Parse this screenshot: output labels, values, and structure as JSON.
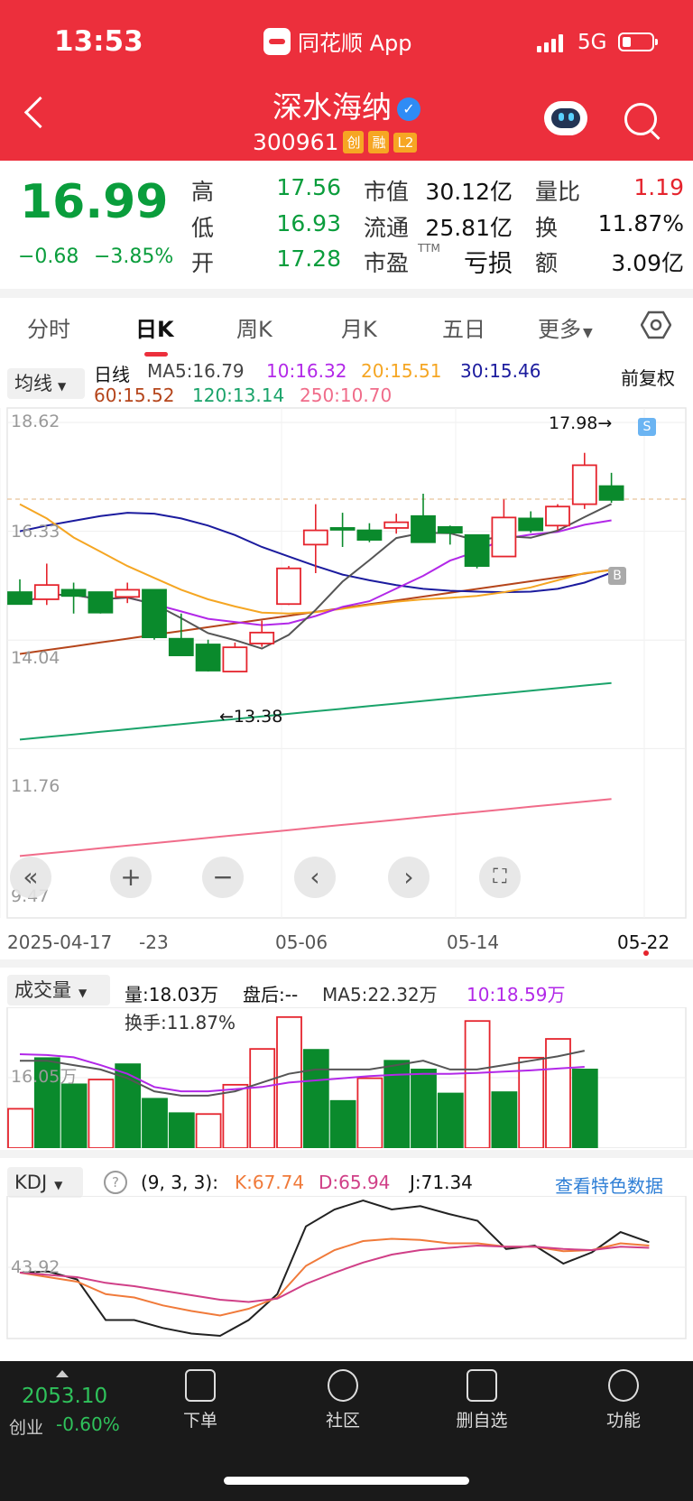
{
  "status": {
    "time": "13:53",
    "app": "同花顺 App",
    "network": "5G"
  },
  "header": {
    "stock_name": "深水海纳",
    "stock_code": "300961",
    "tags": [
      "创",
      "融",
      "L2"
    ]
  },
  "quote": {
    "price": "16.99",
    "change": "−0.68",
    "change_pct": "−3.85%",
    "high_label": "高",
    "high": "17.56",
    "low_label": "低",
    "low": "16.93",
    "open_label": "开",
    "open": "17.28",
    "mcap_label": "市值",
    "mcap": "30.12亿",
    "float_label": "流通",
    "float": "25.81亿",
    "pe_label": "市盈",
    "pe_sup": "TTM",
    "pe": "亏损",
    "vr_label": "量比",
    "vr": "1.19",
    "turn_label": "换",
    "turn": "11.87%",
    "amt_label": "额",
    "amt": "3.09亿"
  },
  "tabs": [
    "分时",
    "日K",
    "周K",
    "月K",
    "五日",
    "更多"
  ],
  "ma_legend": {
    "selector": "均线",
    "period": "日线",
    "ma5": "MA5:16.79",
    "ma10": "10:16.32",
    "ma20": "20:15.51",
    "ma30": "30:15.46",
    "ma60": "60:15.52",
    "ma120": "120:13.14",
    "ma250": "250:10.70",
    "adjust": "前复权"
  },
  "price_axis": [
    "18.62",
    "16.33",
    "14.04",
    "11.76",
    "9.47"
  ],
  "annotations": {
    "high": "17.98→",
    "low": "←13.38",
    "sell": "S",
    "buy": "B"
  },
  "dates": [
    "2025-04-17",
    "-23",
    "05-06",
    "05-14",
    "05-22"
  ],
  "volume_legend": {
    "selector": "成交量",
    "vol": "量:18.03万",
    "after": "盘后:--",
    "ma5": "MA5:22.32万",
    "ma10": "10:18.59万",
    "turnover": "换手:11.87%",
    "axis": "16.05万"
  },
  "kdj_legend": {
    "selector": "KDJ",
    "params": "(9, 3, 3):",
    "k": "K:67.74",
    "d": "D:65.94",
    "j": "J:71.34",
    "link": "查看特色数据",
    "axis": "43.92"
  },
  "bottom": {
    "index_value": "2053.10",
    "index_name": "创业",
    "index_change": "-0.60%",
    "nav": [
      "下单",
      "社区",
      "删自选",
      "功能"
    ]
  },
  "colors": {
    "red": "#e5242d",
    "green": "#0a8a2c",
    "ma5": "#555555",
    "ma10": "#b228e8",
    "ma20": "#f5a623",
    "ma30": "#1b1b9e",
    "ma60": "#b5451b",
    "ma120": "#1aa36a",
    "ma250": "#f06c8a"
  },
  "chart_data": {
    "type": "candlestick",
    "candles": [
      {
        "o": 15.05,
        "h": 15.32,
        "l": 14.85,
        "c": 14.8
      },
      {
        "o": 14.9,
        "h": 15.65,
        "l": 14.78,
        "c": 15.2
      },
      {
        "o": 15.1,
        "h": 15.25,
        "l": 14.6,
        "c": 14.97
      },
      {
        "o": 15.05,
        "h": 15.05,
        "l": 14.6,
        "c": 14.62
      },
      {
        "o": 14.95,
        "h": 15.25,
        "l": 14.82,
        "c": 15.1
      },
      {
        "o": 15.1,
        "h": 15.1,
        "l": 14.05,
        "c": 14.1
      },
      {
        "o": 14.07,
        "h": 14.6,
        "l": 13.75,
        "c": 13.72
      },
      {
        "o": 13.95,
        "h": 14.05,
        "l": 13.38,
        "c": 13.4
      },
      {
        "o": 13.38,
        "h": 13.99,
        "l": 13.38,
        "c": 13.89
      },
      {
        "o": 13.97,
        "h": 14.45,
        "l": 13.9,
        "c": 14.2
      },
      {
        "o": 14.8,
        "h": 15.6,
        "l": 14.78,
        "c": 15.55
      },
      {
        "o": 16.05,
        "h": 16.9,
        "l": 15.45,
        "c": 16.35
      },
      {
        "o": 16.4,
        "h": 16.72,
        "l": 16.0,
        "c": 16.37
      },
      {
        "o": 16.35,
        "h": 16.5,
        "l": 16.1,
        "c": 16.15
      },
      {
        "o": 16.4,
        "h": 16.7,
        "l": 16.28,
        "c": 16.52
      },
      {
        "o": 16.65,
        "h": 17.12,
        "l": 16.1,
        "c": 16.1
      },
      {
        "o": 16.42,
        "h": 16.45,
        "l": 16.05,
        "c": 16.3
      },
      {
        "o": 16.25,
        "h": 16.25,
        "l": 15.55,
        "c": 15.6
      },
      {
        "o": 15.8,
        "h": 17.0,
        "l": 15.8,
        "c": 16.62
      },
      {
        "o": 16.6,
        "h": 16.75,
        "l": 16.3,
        "c": 16.35
      },
      {
        "o": 16.45,
        "h": 16.9,
        "l": 16.35,
        "c": 16.85
      },
      {
        "o": 16.9,
        "h": 17.98,
        "l": 16.8,
        "c": 17.72
      },
      {
        "o": 17.28,
        "h": 17.56,
        "l": 16.93,
        "c": 16.99
      }
    ],
    "volumes": [
      9.0,
      20.6,
      14.6,
      15.7,
      19.2,
      11.3,
      8.0,
      7.8,
      14.5,
      22.7,
      30.0,
      22.5,
      10.8,
      16.0,
      20.0,
      18.0,
      12.5,
      29.1,
      12.8,
      20.7,
      25.0,
      18.0
    ]
  }
}
